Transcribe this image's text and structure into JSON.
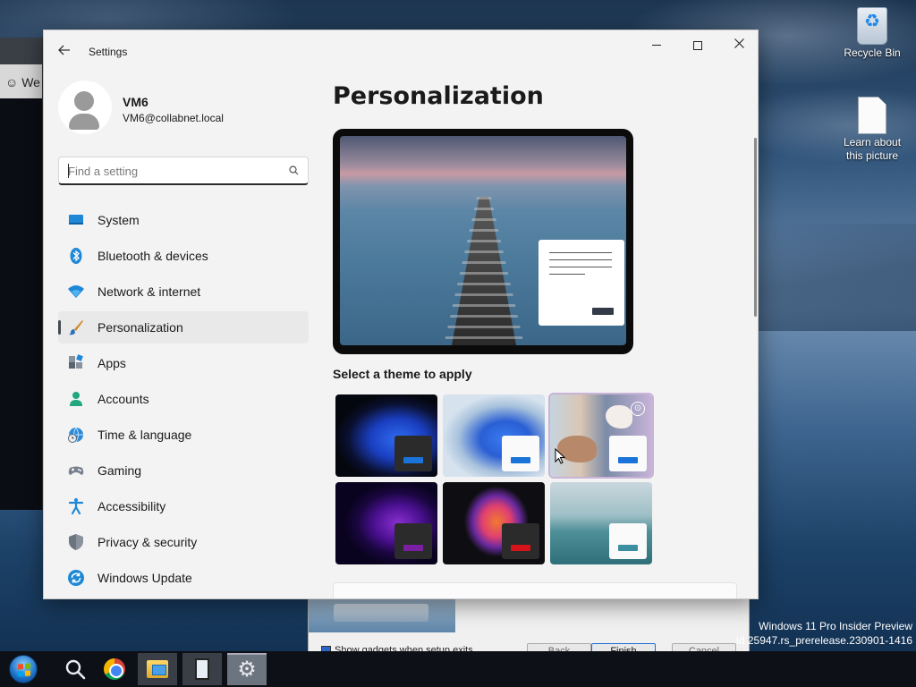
{
  "desktop": {
    "icons": [
      {
        "label": "Recycle Bin"
      },
      {
        "label": "Learn about this picture"
      }
    ],
    "watermark": {
      "line1": "Windows 11 Pro Insider Preview",
      "line2": "ld 25947.rs_prerelease.230901-1416"
    },
    "background_window": {
      "title_fragment": "We"
    },
    "setup_dialog": {
      "checkbox_label": "Show gadgets when setup exits",
      "back_label": "Back",
      "finish_label": "Finish",
      "cancel_label": "Cancel"
    }
  },
  "window": {
    "title": "Settings",
    "back_icon": "back-arrow-icon",
    "controls": [
      "minimize",
      "maximize",
      "close"
    ]
  },
  "user": {
    "name": "VM6",
    "email": "VM6@collabnet.local"
  },
  "search": {
    "placeholder": "Find a setting",
    "value": ""
  },
  "nav": {
    "items": [
      {
        "label": "System",
        "icon": "monitor-icon"
      },
      {
        "label": "Bluetooth & devices",
        "icon": "bluetooth-icon"
      },
      {
        "label": "Network & internet",
        "icon": "wifi-icon"
      },
      {
        "label": "Personalization",
        "icon": "brush-icon",
        "selected": true
      },
      {
        "label": "Apps",
        "icon": "apps-icon"
      },
      {
        "label": "Accounts",
        "icon": "person-icon"
      },
      {
        "label": "Time & language",
        "icon": "globe-clock-icon"
      },
      {
        "label": "Gaming",
        "icon": "gamepad-icon"
      },
      {
        "label": "Accessibility",
        "icon": "accessibility-icon"
      },
      {
        "label": "Privacy & security",
        "icon": "shield-icon"
      },
      {
        "label": "Windows Update",
        "icon": "update-icon"
      }
    ]
  },
  "main": {
    "title": "Personalization",
    "theme_heading": "Select a theme to apply",
    "themes": [
      {
        "name": "dark-bloom",
        "accent": "#1a73d9"
      },
      {
        "name": "light-bloom",
        "accent": "#1a73d9"
      },
      {
        "name": "spotlight",
        "accent": "#1a73d9",
        "selected": true
      },
      {
        "name": "glow",
        "accent": "#7a1fa2"
      },
      {
        "name": "captured-motion",
        "accent": "#d4131b"
      },
      {
        "name": "flow",
        "accent": "#3c8fa0"
      }
    ]
  },
  "taskbar": {
    "items": [
      "start-icon",
      "search-icon",
      "chrome-icon",
      "file-explorer-icon",
      "server-manager-icon",
      "settings-icon"
    ]
  },
  "colors": {
    "window_bg": "#f3f3f3",
    "selected_nav_bg": "#e9e9e9",
    "taskbar_bg": "#0d1016",
    "accent_blue": "#1a73d9"
  }
}
